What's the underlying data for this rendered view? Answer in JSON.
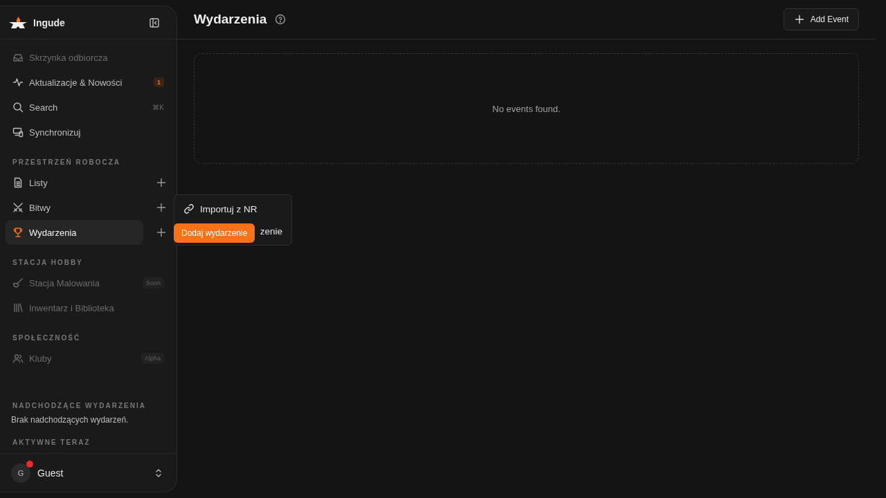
{
  "sidebar": {
    "brand": "Ingude",
    "nav": [
      {
        "label": "Skrzynka odbiorcza",
        "kind": "inbox",
        "disabled": true
      },
      {
        "label": "Aktualizacje & Nowości",
        "kind": "pulse",
        "disabled": false,
        "badge": "1"
      },
      {
        "label": "Search",
        "kind": "search",
        "disabled": false,
        "shortcut": "⌘K"
      },
      {
        "label": "Synchronizuj",
        "kind": "devices",
        "disabled": false
      }
    ],
    "sections": [
      {
        "title": "PRZESTRZEŃ ROBOCZA",
        "items": [
          {
            "label": "Listy",
            "kind": "doc",
            "disabled": false,
            "selected": false,
            "add": true
          },
          {
            "label": "Bitwy",
            "kind": "swords",
            "disabled": false,
            "selected": false,
            "add": true
          },
          {
            "label": "Wydarzenia",
            "kind": "trophy",
            "disabled": false,
            "selected": true,
            "add": true
          }
        ]
      },
      {
        "title": "STACJA HOBBY",
        "items": [
          {
            "label": "Stacja Malowania",
            "kind": "brush",
            "disabled": true,
            "selected": false,
            "tag": "Soon"
          },
          {
            "label": "Inwentarz i Biblioteka",
            "kind": "library",
            "disabled": true,
            "selected": false
          }
        ]
      },
      {
        "title": "SPOŁECZNOŚĆ",
        "items": [
          {
            "label": "Kluby",
            "kind": "users",
            "disabled": true,
            "selected": false,
            "tag": "Alpha"
          }
        ]
      }
    ],
    "upcoming": {
      "title": "NADCHODZĄCE WYDARZENIA",
      "text": "Brak nadchodzących wydarzeń."
    },
    "active": {
      "title": "AKTYWNE TERAZ"
    },
    "user": {
      "initial": "G",
      "name": "Guest",
      "notification": true
    }
  },
  "header": {
    "title": "Wydarzenia",
    "button": "Add Event"
  },
  "empty": "No events found.",
  "menu": {
    "items": [
      {
        "label": "Importuj z NR",
        "kind": "link"
      },
      {
        "label": "zenie",
        "kind": "covered"
      }
    ],
    "tooltip": "Dodaj wydarzenie"
  }
}
